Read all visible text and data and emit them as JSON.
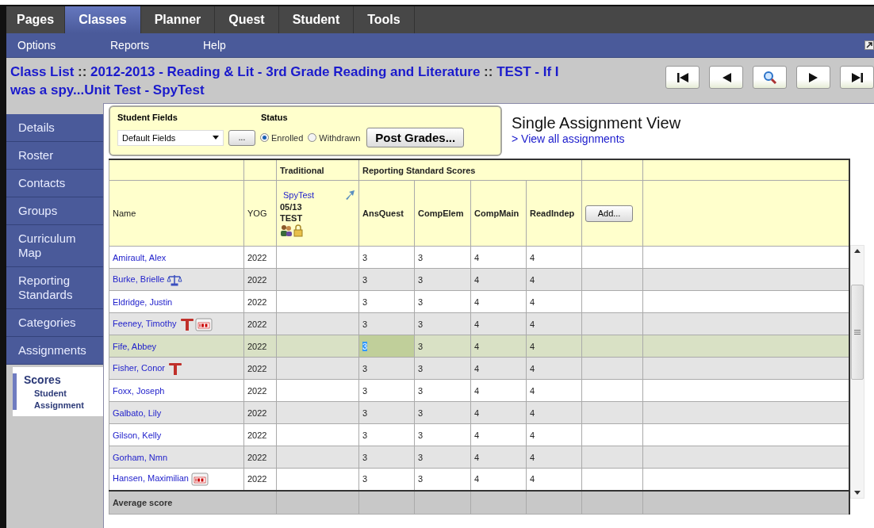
{
  "top_tabs": [
    {
      "label": "Pages",
      "selected": false
    },
    {
      "label": "Classes",
      "selected": true
    },
    {
      "label": "Planner",
      "selected": false
    },
    {
      "label": "Quest",
      "selected": false
    },
    {
      "label": "Student",
      "selected": false
    },
    {
      "label": "Tools",
      "selected": false
    }
  ],
  "submenu": [
    "Options",
    "Reports",
    "Help"
  ],
  "breadcrumb": [
    {
      "text": "Class List",
      "kind": "link"
    },
    {
      "text": "::",
      "kind": "separator"
    },
    {
      "text": "2012-2013 - Reading & Lit - 3rd Grade Reading and Literature",
      "kind": "link"
    },
    {
      "text": "::",
      "kind": "separator"
    },
    {
      "text": "TEST - If I was a spy...Unit Test - SpyTest",
      "kind": "link"
    }
  ],
  "record_nav": [
    {
      "kind": "first"
    },
    {
      "kind": "previous"
    },
    {
      "kind": "search"
    },
    {
      "kind": "next"
    },
    {
      "kind": "last"
    }
  ],
  "sidebar": {
    "items": [
      {
        "label": "Details",
        "selected": false
      },
      {
        "label": "Roster",
        "selected": false
      },
      {
        "label": "Contacts",
        "selected": false
      },
      {
        "label": "Groups",
        "selected": false
      },
      {
        "label": "Curriculum Map",
        "selected": false
      },
      {
        "label": "Reporting Standards",
        "selected": false
      },
      {
        "label": "Categories",
        "selected": false
      },
      {
        "label": "Assignments",
        "selected": false
      },
      {
        "label": "Scores",
        "selected": true,
        "children": [
          "Student",
          "Assignment"
        ]
      }
    ]
  },
  "filters": {
    "student_fields_label": "Student Fields",
    "student_fields_value": "Default Fields",
    "more_button": "...",
    "status_label": "Status",
    "status_options": [
      {
        "label": "Enrolled",
        "selected": true
      },
      {
        "label": "Withdrawn",
        "selected": false
      }
    ],
    "post_button": "Post Grades..."
  },
  "view": {
    "title": "Single Assignment View",
    "link": "> View all assignments"
  },
  "table": {
    "group_headers": [
      "Traditional",
      "Reporting Standard Scores"
    ],
    "columns": [
      "Name",
      "YOG",
      "AnsQuest",
      "CompElem",
      "CompMain",
      "ReadIndep"
    ],
    "assignment": {
      "name": "SpyTest",
      "date": "05/13",
      "category": "TEST"
    },
    "add_button": "Add...",
    "rows": [
      {
        "name": "Amirault, Alex",
        "yog": "2022",
        "flags": [],
        "selected": false,
        "scores": [
          {
            "value": "3",
            "active": false
          },
          {
            "value": "3",
            "active": false
          },
          {
            "value": "4",
            "active": false
          },
          {
            "value": "4",
            "active": false
          }
        ]
      },
      {
        "name": "Burke, Brielle",
        "yog": "2022",
        "flags": [
          {
            "kind": "legal"
          }
        ],
        "selected": false,
        "scores": [
          {
            "value": "3",
            "active": false
          },
          {
            "value": "3",
            "active": false
          },
          {
            "value": "4",
            "active": false
          },
          {
            "value": "4",
            "active": false
          }
        ]
      },
      {
        "name": "Eldridge, Justin",
        "yog": "2022",
        "flags": [],
        "selected": false,
        "scores": [
          {
            "value": "3",
            "active": false
          },
          {
            "value": "3",
            "active": false
          },
          {
            "value": "4",
            "active": false
          },
          {
            "value": "4",
            "active": false
          }
        ]
      },
      {
        "name": "Feeney, Timothy",
        "yog": "2022",
        "flags": [
          {
            "kind": "medical"
          },
          {
            "kind": "iep"
          }
        ],
        "selected": false,
        "scores": [
          {
            "value": "3",
            "active": false
          },
          {
            "value": "3",
            "active": false
          },
          {
            "value": "4",
            "active": false
          },
          {
            "value": "4",
            "active": false
          }
        ]
      },
      {
        "name": "Fife, Abbey",
        "yog": "2022",
        "flags": [],
        "selected": true,
        "scores": [
          {
            "value": "3",
            "active": true
          },
          {
            "value": "3",
            "active": false
          },
          {
            "value": "4",
            "active": false
          },
          {
            "value": "4",
            "active": false
          }
        ]
      },
      {
        "name": "Fisher, Conor",
        "yog": "2022",
        "flags": [
          {
            "kind": "medical"
          }
        ],
        "selected": false,
        "scores": [
          {
            "value": "3",
            "active": false
          },
          {
            "value": "3",
            "active": false
          },
          {
            "value": "4",
            "active": false
          },
          {
            "value": "4",
            "active": false
          }
        ]
      },
      {
        "name": "Foxx, Joseph",
        "yog": "2022",
        "flags": [],
        "selected": false,
        "scores": [
          {
            "value": "3",
            "active": false
          },
          {
            "value": "3",
            "active": false
          },
          {
            "value": "4",
            "active": false
          },
          {
            "value": "4",
            "active": false
          }
        ]
      },
      {
        "name": "Galbato, Lily",
        "yog": "2022",
        "flags": [],
        "selected": false,
        "scores": [
          {
            "value": "3",
            "active": false
          },
          {
            "value": "3",
            "active": false
          },
          {
            "value": "4",
            "active": false
          },
          {
            "value": "4",
            "active": false
          }
        ]
      },
      {
        "name": "Gilson, Kelly",
        "yog": "2022",
        "flags": [],
        "selected": false,
        "scores": [
          {
            "value": "3",
            "active": false
          },
          {
            "value": "3",
            "active": false
          },
          {
            "value": "4",
            "active": false
          },
          {
            "value": "4",
            "active": false
          }
        ]
      },
      {
        "name": "Gorham, Nmn",
        "yog": "2022",
        "flags": [],
        "selected": false,
        "scores": [
          {
            "value": "3",
            "active": false
          },
          {
            "value": "3",
            "active": false
          },
          {
            "value": "4",
            "active": false
          },
          {
            "value": "4",
            "active": false
          }
        ]
      },
      {
        "name": "Hansen, Maximilian",
        "yog": "2022",
        "flags": [
          {
            "kind": "iep"
          }
        ],
        "selected": false,
        "scores": [
          {
            "value": "3",
            "active": false
          },
          {
            "value": "3",
            "active": false
          },
          {
            "value": "4",
            "active": false
          },
          {
            "value": "4",
            "active": false
          }
        ]
      }
    ],
    "footer_label": "Average score"
  }
}
